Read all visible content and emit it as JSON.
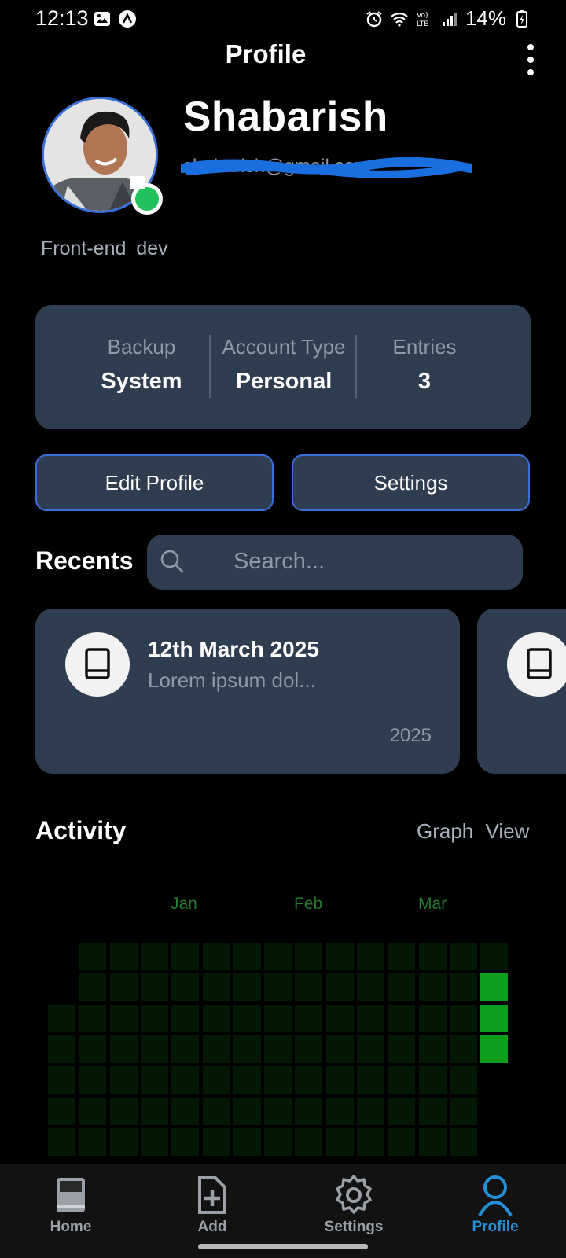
{
  "status_bar": {
    "time": "12:13",
    "battery": "14%"
  },
  "header": {
    "title": "Profile"
  },
  "profile": {
    "name": "Shabarish",
    "email_redacted": "shabarish@gmail.com",
    "role": "Front-end dev",
    "status_color": "#21c25b"
  },
  "stats": [
    {
      "label": "Backup",
      "value": "System"
    },
    {
      "label": "Account Type",
      "value": "Personal"
    },
    {
      "label": "Entries",
      "value": "3"
    }
  ],
  "buttons": {
    "edit_profile": "Edit Profile",
    "settings": "Settings"
  },
  "recents": {
    "title": "Recents",
    "search_placeholder": "Search...",
    "items": [
      {
        "date": "12th March 2025",
        "snippet": "Lorem ipsum dol...",
        "year": "2025"
      }
    ]
  },
  "activity": {
    "title": "Activity",
    "graph_view": "Graph View",
    "months": [
      "Jan",
      "Feb",
      "Mar"
    ],
    "active_cells": [
      {
        "week": 14,
        "day": 1
      },
      {
        "week": 14,
        "day": 2
      },
      {
        "week": 14,
        "day": 3
      }
    ]
  },
  "bottom_nav": {
    "items": [
      {
        "label": "Home",
        "icon": "notebook-icon"
      },
      {
        "label": "Add",
        "icon": "add-file-icon"
      },
      {
        "label": "Settings",
        "icon": "gear-icon"
      },
      {
        "label": "Profile",
        "icon": "user-icon"
      }
    ],
    "active": "Profile",
    "active_color": "#2490d6"
  },
  "colors": {
    "card": "#2e3e50",
    "accent_border": "#3b6fd8",
    "activity_green": "#0e9e1b"
  }
}
